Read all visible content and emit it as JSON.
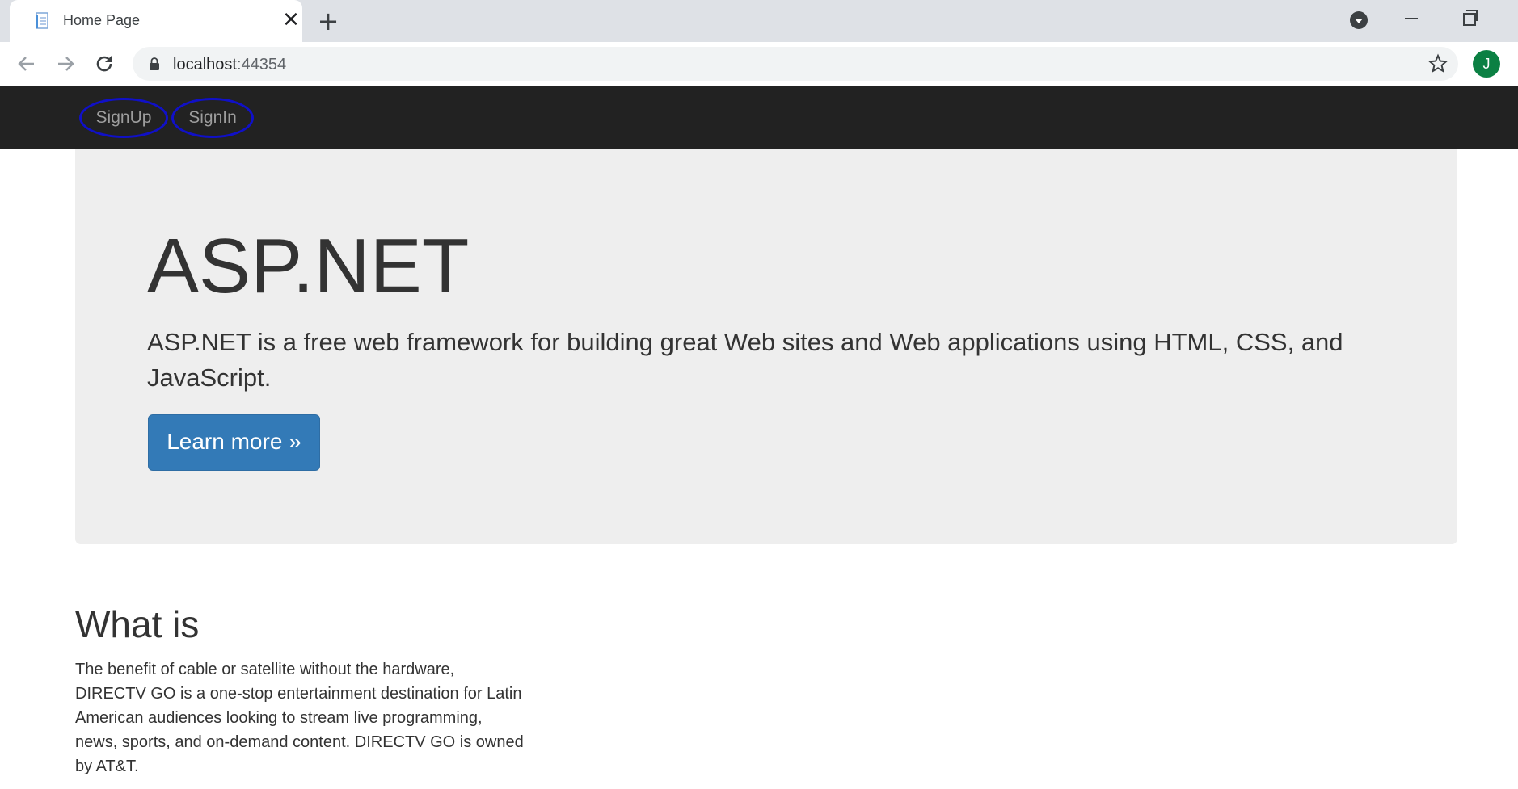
{
  "browser": {
    "tab_title": "Home Page",
    "tab_close_glyph": "✕",
    "new_tab_glyph": "+",
    "url_host": "localhost",
    "url_port": ":44354",
    "profile_initial": "J",
    "icons": [
      "page-favicon-icon",
      "back-arrow-icon",
      "forward-arrow-icon",
      "reload-icon",
      "lock-icon",
      "star-icon",
      "tab-search-icon",
      "minimize-icon",
      "restore-icon"
    ]
  },
  "navbar": {
    "links": [
      {
        "label": "SignUp"
      },
      {
        "label": "SignIn"
      }
    ],
    "highlight_color": "#1010c8",
    "background": "#222222"
  },
  "jumbotron": {
    "title": "ASP.NET",
    "lead": "ASP.NET is a free web framework for building great Web sites and Web applications using HTML, CSS, and JavaScript.",
    "button_label": "Learn more »",
    "button_color": "#337ab7"
  },
  "section": {
    "title": "What is",
    "body": "The benefit of cable or satellite without the hardware, DIRECTV GO is a one-stop entertainment destination for Latin American audiences looking to stream live programming, news, sports, and on-demand content. DIRECTV GO is owned by AT&T."
  }
}
